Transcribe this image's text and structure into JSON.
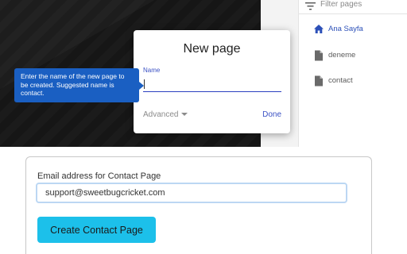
{
  "pages_panel": {
    "filter_placeholder": "Filter pages",
    "filter_icon": "filter-icon",
    "items": [
      {
        "label": "Ana Sayfa",
        "icon": "home-icon",
        "active": true
      },
      {
        "label": "deneme",
        "icon": "page-icon",
        "active": false
      },
      {
        "label": "contact",
        "icon": "page-icon",
        "active": false
      }
    ]
  },
  "dialog": {
    "title": "New page",
    "name_label": "Name",
    "name_value": "",
    "advanced_label": "Advanced",
    "done_label": "Done"
  },
  "tooltip": {
    "text": "Enter the name of the new page to be created. Suggested name is contact."
  },
  "contact_form": {
    "email_label": "Email address for Contact Page",
    "email_value": "support@sweetbugcricket.com",
    "create_button_label": "Create Contact Page"
  },
  "colors": {
    "accent_blue": "#3b51c4",
    "tooltip_bg": "#1a5fc2",
    "button_cyan": "#1cc0ea",
    "input_focus": "#bcd7f3"
  }
}
